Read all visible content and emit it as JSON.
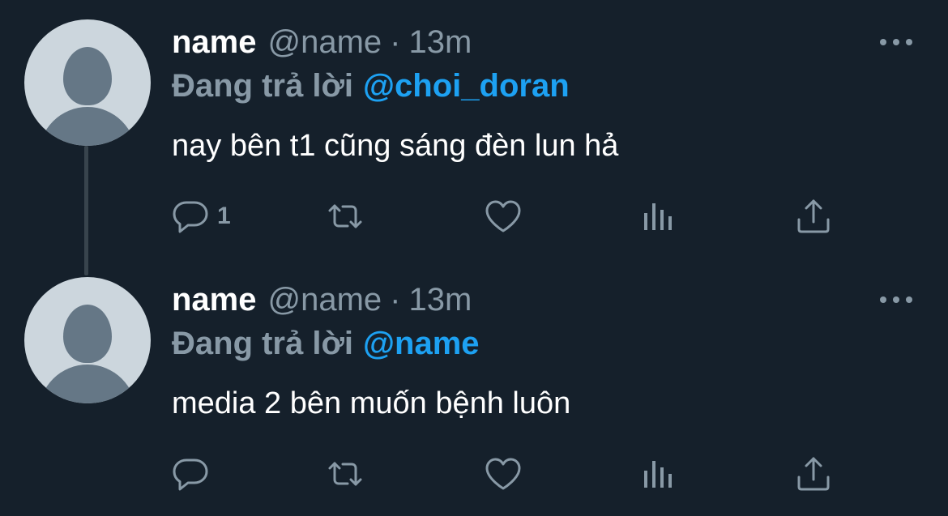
{
  "colors": {
    "background": "#15202b",
    "primary_text": "#ffffff",
    "secondary_text": "#8899a6",
    "accent": "#1da1f2",
    "thread_line": "#38444d",
    "avatar_bg": "#ccd6dd",
    "avatar_fg": "#657786"
  },
  "tweets": [
    {
      "display_name": "name",
      "handle": "@name",
      "separator": "·",
      "time": "13m",
      "reply_prefix": "Đang trả lời",
      "reply_target": "@choi_doran",
      "text": "nay bên t1 cũng sáng đèn lun hả",
      "reply_count": "1",
      "icons": [
        "reply-icon",
        "retweet-icon",
        "like-icon",
        "analytics-icon",
        "share-icon",
        "more-icon"
      ]
    },
    {
      "display_name": "name",
      "handle": "@name",
      "separator": "·",
      "time": "13m",
      "reply_prefix": "Đang trả lời",
      "reply_target": "@name",
      "text": "media 2 bên muốn bệnh luôn",
      "reply_count": "",
      "icons": [
        "reply-icon",
        "retweet-icon",
        "like-icon",
        "analytics-icon",
        "share-icon",
        "more-icon"
      ]
    }
  ]
}
